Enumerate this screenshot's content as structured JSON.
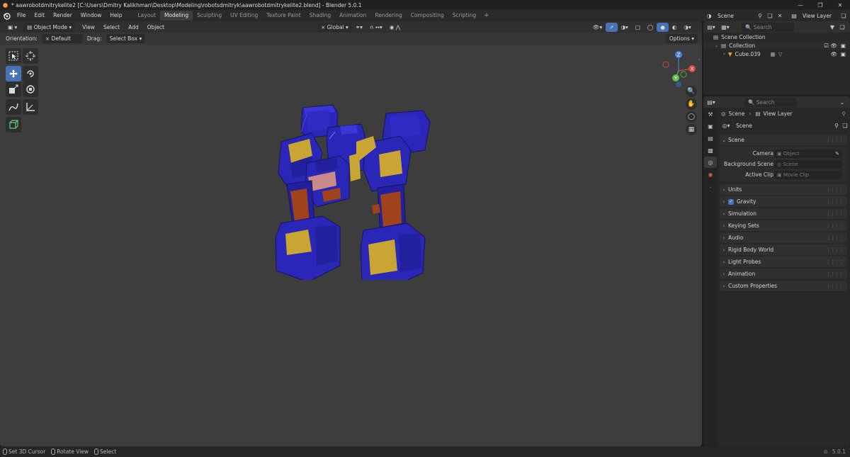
{
  "window": {
    "title": "* aawrobotdmitrykelite2 [C:\\Users\\Dmitry Kalikhman\\Desktop\\Modeling\\robotsdmitryk\\aawrobotdmitrykelite2.blend] - Blender 5.0.1",
    "controls": [
      "minimize-icon",
      "maximize-icon",
      "close-icon"
    ]
  },
  "menubar": {
    "menus": [
      "File",
      "Edit",
      "Render",
      "Window",
      "Help"
    ],
    "workspaces": [
      "Layout",
      "Modeling",
      "Sculpting",
      "UV Editing",
      "Texture Paint",
      "Shading",
      "Animation",
      "Rendering",
      "Compositing",
      "Scripting"
    ],
    "active_workspace": "Modeling",
    "add_workspace": "+",
    "scene": "Scene",
    "view_layer": "View Layer"
  },
  "viewport": {
    "mode": "Object Mode",
    "menus": [
      "View",
      "Select",
      "Add",
      "Object"
    ],
    "transform_orientation": "Global",
    "orientation_label": "Orientation:",
    "orientation_value": "Default",
    "drag_label": "Drag:",
    "drag_value": "Select Box",
    "options": "Options",
    "gizmo_axes": [
      "Z",
      "X",
      "Y"
    ]
  },
  "outliner": {
    "search_placeholder": "Search",
    "root": "Scene Collection",
    "collection": "Collection",
    "object": "Cube.039"
  },
  "properties": {
    "search_placeholder": "Search",
    "breadcrumb": [
      "Scene",
      "View Layer"
    ],
    "datablock": "Scene",
    "scene_panel": {
      "title": "Scene",
      "camera_label": "Camera",
      "camera_placeholder": "Object",
      "background_label": "Background Scene",
      "background_placeholder": "Scene",
      "clip_label": "Active Clip",
      "clip_placeholder": "Movie Clip"
    },
    "panels": [
      "Units",
      "Gravity",
      "Simulation",
      "Keying Sets",
      "Audio",
      "Rigid Body World",
      "Light Probes",
      "Animation",
      "Custom Properties"
    ],
    "gravity_checked": true
  },
  "statusbar": {
    "items": [
      "Set 3D Cursor",
      "Rotate View",
      "Select"
    ],
    "version": "5.0.1"
  },
  "colors": {
    "accent": "#4772b3",
    "model_blue": "#2a26b8",
    "model_yellow": "#c9a534",
    "model_orange": "#a0421c"
  }
}
